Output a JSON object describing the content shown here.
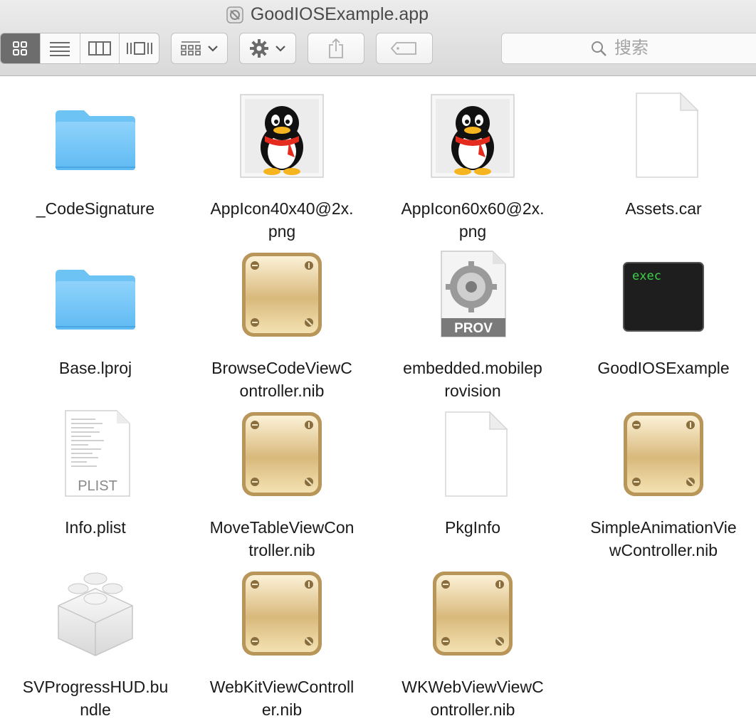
{
  "window": {
    "title": "GoodIOSExample.app"
  },
  "toolbar": {
    "view_modes": [
      "icon-view",
      "list-view",
      "column-view",
      "cover-flow-view"
    ],
    "active_view": "icon-view",
    "search_placeholder": "搜索"
  },
  "files": [
    {
      "name": "_CodeSignature",
      "kind": "folder"
    },
    {
      "name": "AppIcon40x40@2x.\npng",
      "kind": "penguin"
    },
    {
      "name": "AppIcon60x60@2x.\npng",
      "kind": "penguin"
    },
    {
      "name": "Assets.car",
      "kind": "blank"
    },
    {
      "name": "Base.lproj",
      "kind": "folder"
    },
    {
      "name": "BrowseCodeViewC\nontroller.nib",
      "kind": "nib"
    },
    {
      "name": "embedded.mobilep\nrovision",
      "kind": "prov",
      "badge": "PROV"
    },
    {
      "name": "GoodIOSExample",
      "kind": "exec",
      "badge": "exec"
    },
    {
      "name": "Info.plist",
      "kind": "plist",
      "badge": "PLIST"
    },
    {
      "name": "MoveTableViewCon\ntroller.nib",
      "kind": "nib"
    },
    {
      "name": "PkgInfo",
      "kind": "blank"
    },
    {
      "name": "SimpleAnimationVie\nwController.nib",
      "kind": "nib"
    },
    {
      "name": "SVProgressHUD.bu\nndle",
      "kind": "bundle"
    },
    {
      "name": "WebKitViewControll\ner.nib",
      "kind": "nib"
    },
    {
      "name": "WKWebViewViewC\nontroller.nib",
      "kind": "nib"
    }
  ]
}
